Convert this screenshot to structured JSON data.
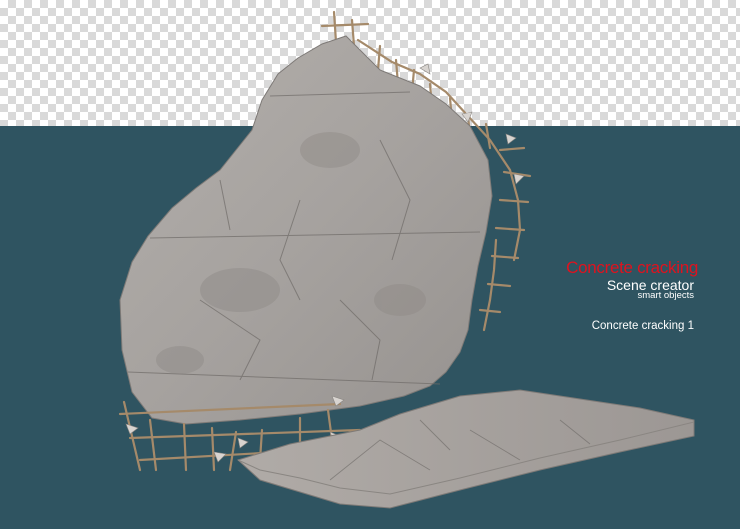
{
  "text": {
    "title": "Concrete cracking",
    "subtitle": "Scene creator",
    "tagline": "smart objects",
    "caption": "Concrete cracking 1"
  },
  "colors": {
    "background_band": "#2f5461",
    "title": "#e0121e",
    "text": "#ffffff",
    "concrete": "#a8a4a1",
    "rebar": "#a58a6a"
  }
}
